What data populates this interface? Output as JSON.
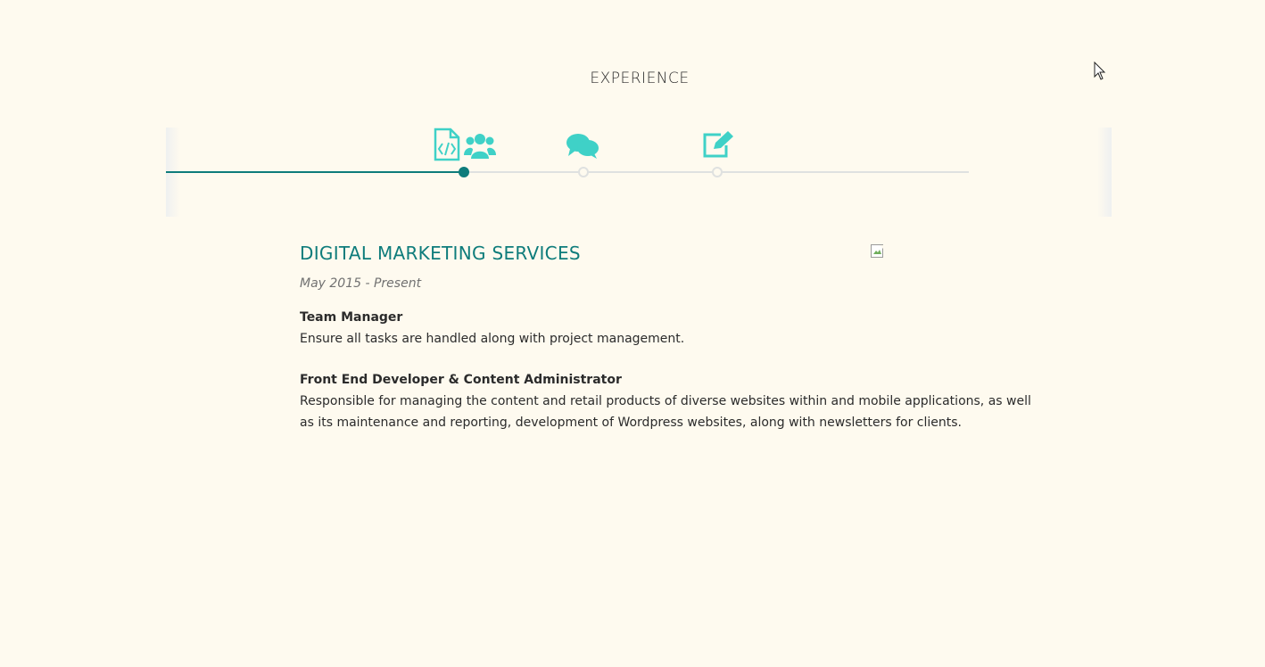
{
  "section": {
    "title": "EXPERIENCE"
  },
  "timeline": {
    "icons": [
      "code-file-icon",
      "users-icon",
      "chat-icon",
      "edit-icon"
    ],
    "accent_color": "#0e7c7b",
    "icon_color": "#3fd1c7",
    "track_color": "#dfe1e0",
    "active_index": 0
  },
  "entry": {
    "company": "DIGITAL MARKETING SERVICES",
    "dates": "May 2015 - Present",
    "roles": [
      {
        "title": "Team Manager",
        "description": "Ensure all tasks are handled along with project management."
      },
      {
        "title": "Front End Developer & Content Administrator",
        "description": "Responsible for managing the content and retail products of diverse websites within and mobile applications, as well as its maintenance and reporting, development of Wordpress websites, along with newsletters for clients."
      }
    ]
  }
}
